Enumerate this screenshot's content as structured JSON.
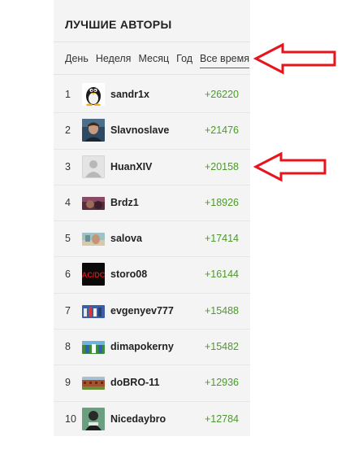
{
  "widget": {
    "title": "ЛУЧШИЕ АВТОРЫ",
    "tabs": [
      "День",
      "Неделя",
      "Месяц",
      "Год",
      "Все время"
    ],
    "active_tab": "Все время"
  },
  "authors": [
    {
      "rank": "1",
      "name": "sandr1x",
      "score": "+26220",
      "avatar": "penguin-avatar"
    },
    {
      "rank": "2",
      "name": "Slavnoslave",
      "score": "+21476",
      "avatar": "portrait-avatar"
    },
    {
      "rank": "3",
      "name": "HuanXIV",
      "score": "+20158",
      "avatar": "default-avatar"
    },
    {
      "rank": "4",
      "name": "Brdz1",
      "score": "+18926",
      "avatar": "photo-avatar"
    },
    {
      "rank": "5",
      "name": "salova",
      "score": "+17414",
      "avatar": "photo-avatar"
    },
    {
      "rank": "6",
      "name": "storo08",
      "score": "+16144",
      "avatar": "acdc-logo-avatar"
    },
    {
      "rank": "7",
      "name": "evgenyev777",
      "score": "+15488",
      "avatar": "photo-avatar"
    },
    {
      "rank": "8",
      "name": "dimapokerny",
      "score": "+15482",
      "avatar": "photo-avatar"
    },
    {
      "rank": "9",
      "name": "doBRO-11",
      "score": "+12936",
      "avatar": "photo-avatar"
    },
    {
      "rank": "10",
      "name": "Nicedaybro",
      "score": "+12784",
      "avatar": "photo-avatar"
    }
  ],
  "colors": {
    "score_green": "#4b9a2a",
    "active_tab_underline": "#d0313b",
    "annotation_arrow": "#e8141c",
    "panel_background": "#f4f4f4"
  },
  "annotations": {
    "arrow_1_points_to": "Все время",
    "arrow_2_points_to": "+20158"
  }
}
